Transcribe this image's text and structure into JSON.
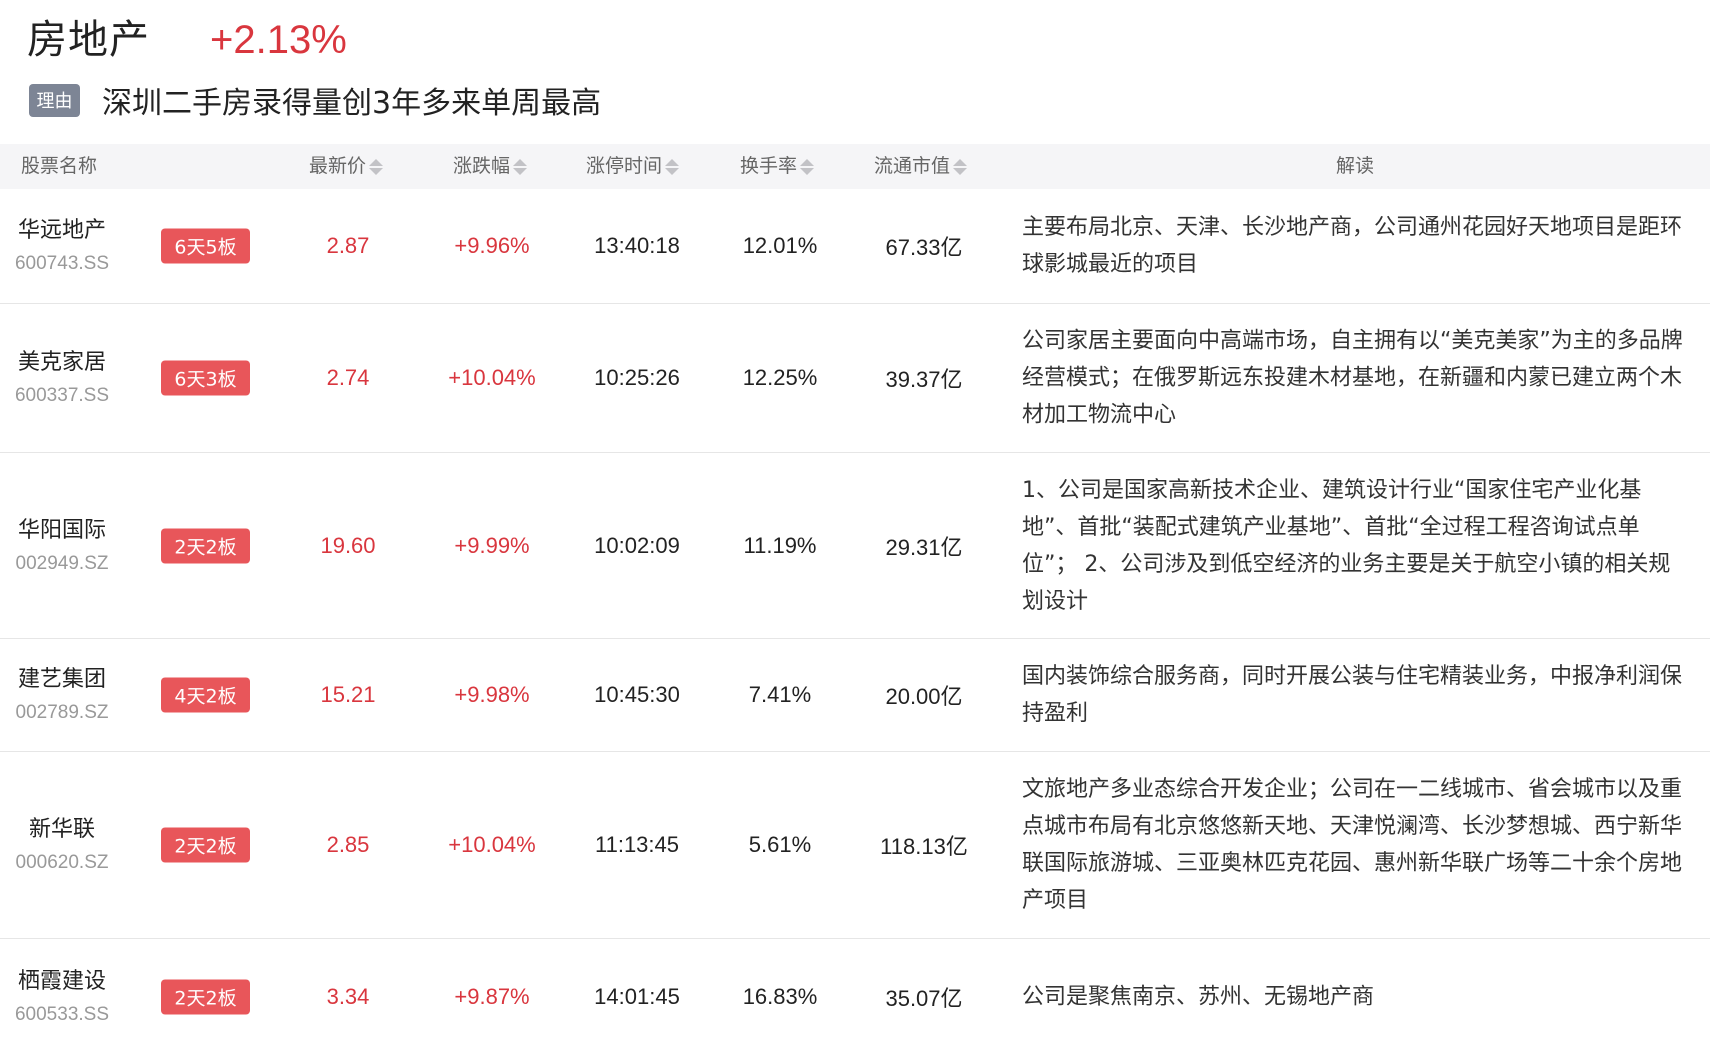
{
  "header": {
    "sector_name": "房地产",
    "sector_change": "+2.13%",
    "reason_tag": "理由",
    "reason_text": "深圳二手房录得量创3年多来单周最高"
  },
  "columns": {
    "name": "股票名称",
    "price": "最新价",
    "change": "涨跌幅",
    "limit_time": "涨停时间",
    "turnover": "换手率",
    "float_cap": "流通市值",
    "interpretation": "解读"
  },
  "rows": [
    {
      "name": "华远地产",
      "code": "600743.SS",
      "board": "6天5板",
      "price": "2.87",
      "change": "+9.96%",
      "time": "13:40:18",
      "turnover": "12.01%",
      "cap": "67.33亿",
      "desc": "主要布局北京、天津、长沙地产商，公司通州花园好天地项目是距环球影城最近的项目"
    },
    {
      "name": "美克家居",
      "code": "600337.SS",
      "board": "6天3板",
      "price": "2.74",
      "change": "+10.04%",
      "time": "10:25:26",
      "turnover": "12.25%",
      "cap": "39.37亿",
      "desc": "公司家居主要面向中高端市场，自主拥有以“美克美家”为主的多品牌经营模式；在俄罗斯远东投建木材基地，在新疆和内蒙已建立两个木材加工物流中心"
    },
    {
      "name": "华阳国际",
      "code": "002949.SZ",
      "board": "2天2板",
      "price": "19.60",
      "change": "+9.99%",
      "time": "10:02:09",
      "turnover": "11.19%",
      "cap": "29.31亿",
      "desc": "1、公司是国家高新技术企业、建筑设计行业“国家住宅产业化基地”、首批“装配式建筑产业基地”、首批“全过程工程咨询试点单位”； 2、公司涉及到低空经济的业务主要是关于航空小镇的相关规划设计"
    },
    {
      "name": "建艺集团",
      "code": "002789.SZ",
      "board": "4天2板",
      "price": "15.21",
      "change": "+9.98%",
      "time": "10:45:30",
      "turnover": "7.41%",
      "cap": "20.00亿",
      "desc": "国内装饰综合服务商，同时开展公装与住宅精装业务，中报净利润保持盈利"
    },
    {
      "name": "新华联",
      "code": "000620.SZ",
      "board": "2天2板",
      "price": "2.85",
      "change": "+10.04%",
      "time": "11:13:45",
      "turnover": "5.61%",
      "cap": "118.13亿",
      "desc": "文旅地产多业态综合开发企业；公司在一二线城市、省会城市以及重点城市布局有北京悠悠新天地、天津悦澜湾、长沙梦想城、西宁新华联国际旅游城、三亚奥林匹克花园、惠州新华联广场等二十余个房地产项目"
    },
    {
      "name": "栖霞建设",
      "code": "600533.SS",
      "board": "2天2板",
      "price": "3.34",
      "change": "+9.87%",
      "time": "14:01:45",
      "turnover": "16.83%",
      "cap": "35.07亿",
      "desc": "公司是聚焦南京、苏州、无锡地产商"
    }
  ]
}
